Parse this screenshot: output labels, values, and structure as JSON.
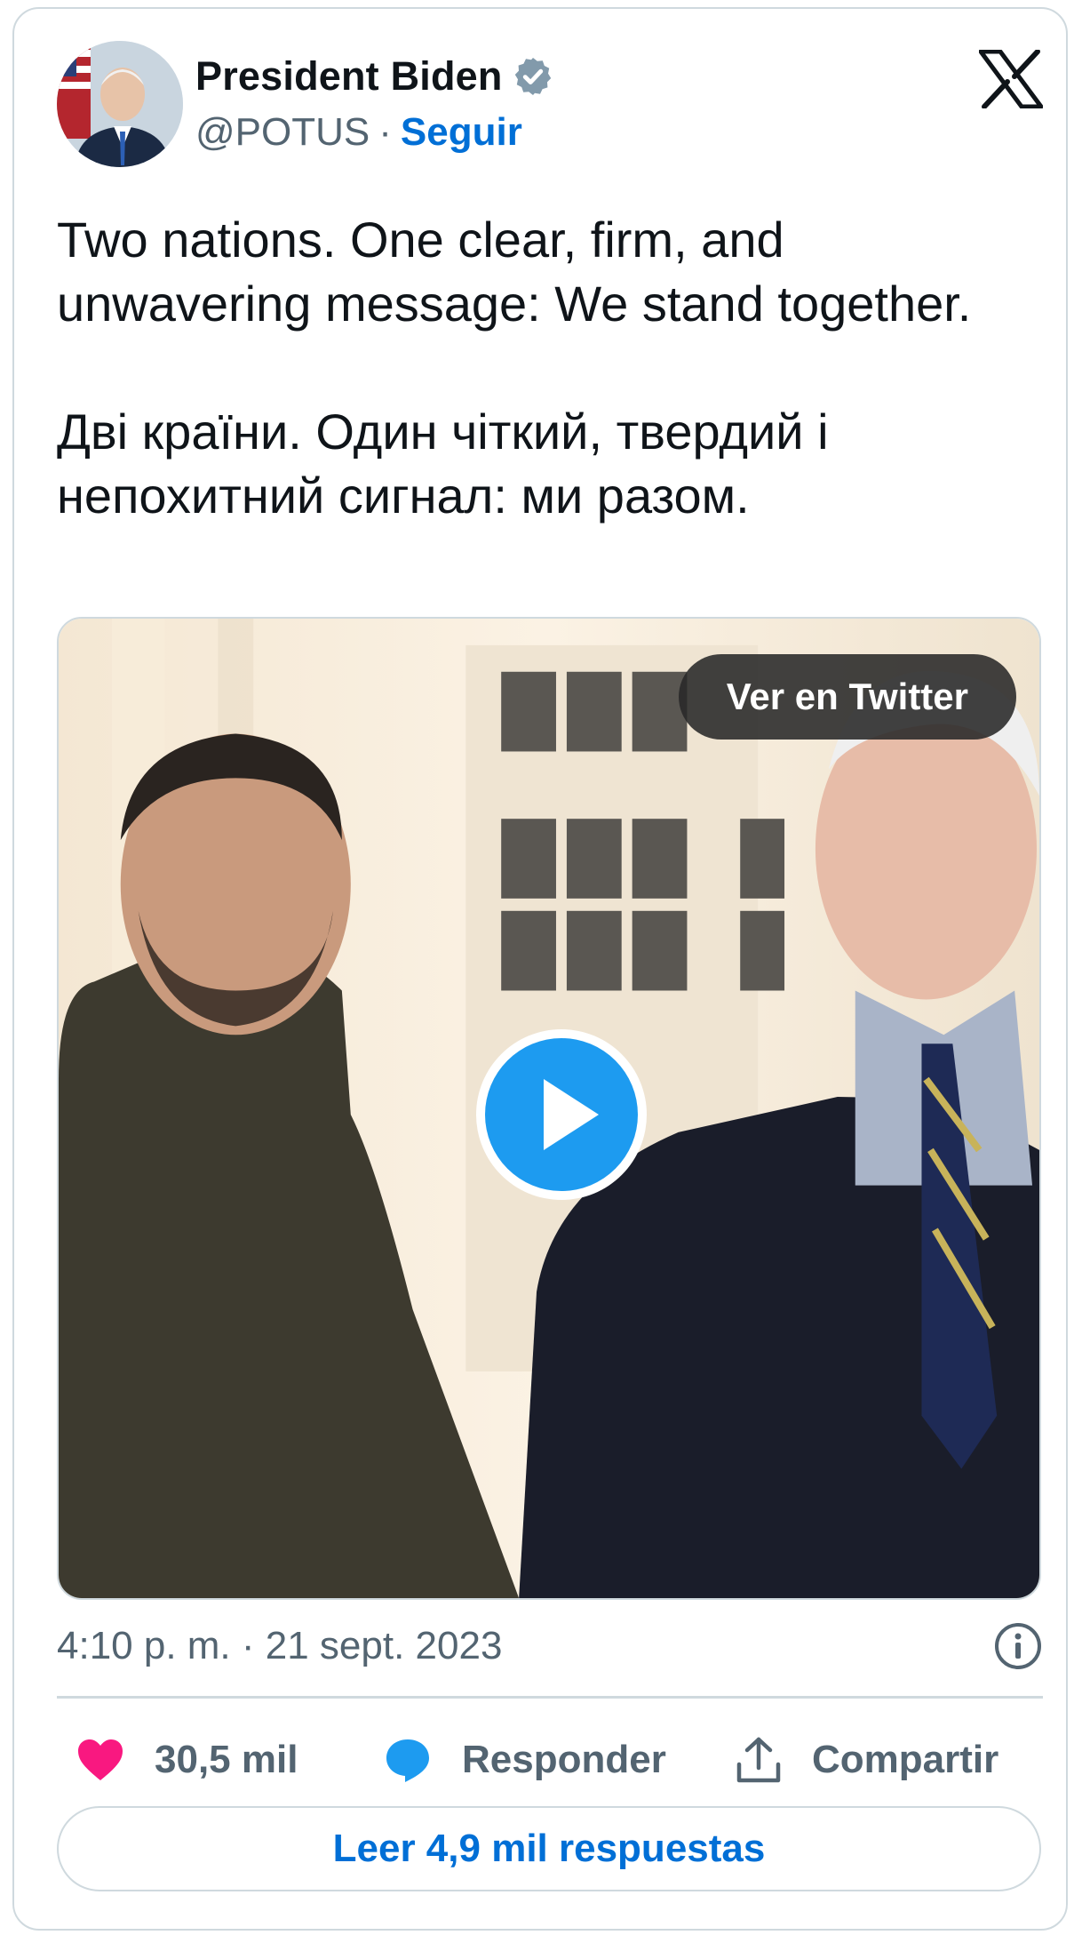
{
  "author": {
    "name": "President Biden",
    "handle": "@POTUS",
    "separator": "·",
    "follow_label": "Seguir",
    "avatar_icon": "profile-photo"
  },
  "tweet": {
    "text": "Two nations. One clear, firm, and unwavering message: We stand together.\n\nДві країни. Один чіткий, твердий і непохитний сигнал: ми разом."
  },
  "media": {
    "view_label": "Ver en Twitter",
    "play_icon": "play-icon"
  },
  "meta": {
    "timestamp": "4:10 p. m. · 21 sept. 2023",
    "info_icon": "info-icon"
  },
  "actions": {
    "likes": "30,5 mil",
    "reply_label": "Responder",
    "share_label": "Compartir"
  },
  "read_replies_label": "Leer 4,9 mil respuestas",
  "colors": {
    "accent": "#006fd6",
    "play": "#1d9bf0",
    "like": "#f91880",
    "muted": "#536471",
    "border": "#cfd9de"
  }
}
